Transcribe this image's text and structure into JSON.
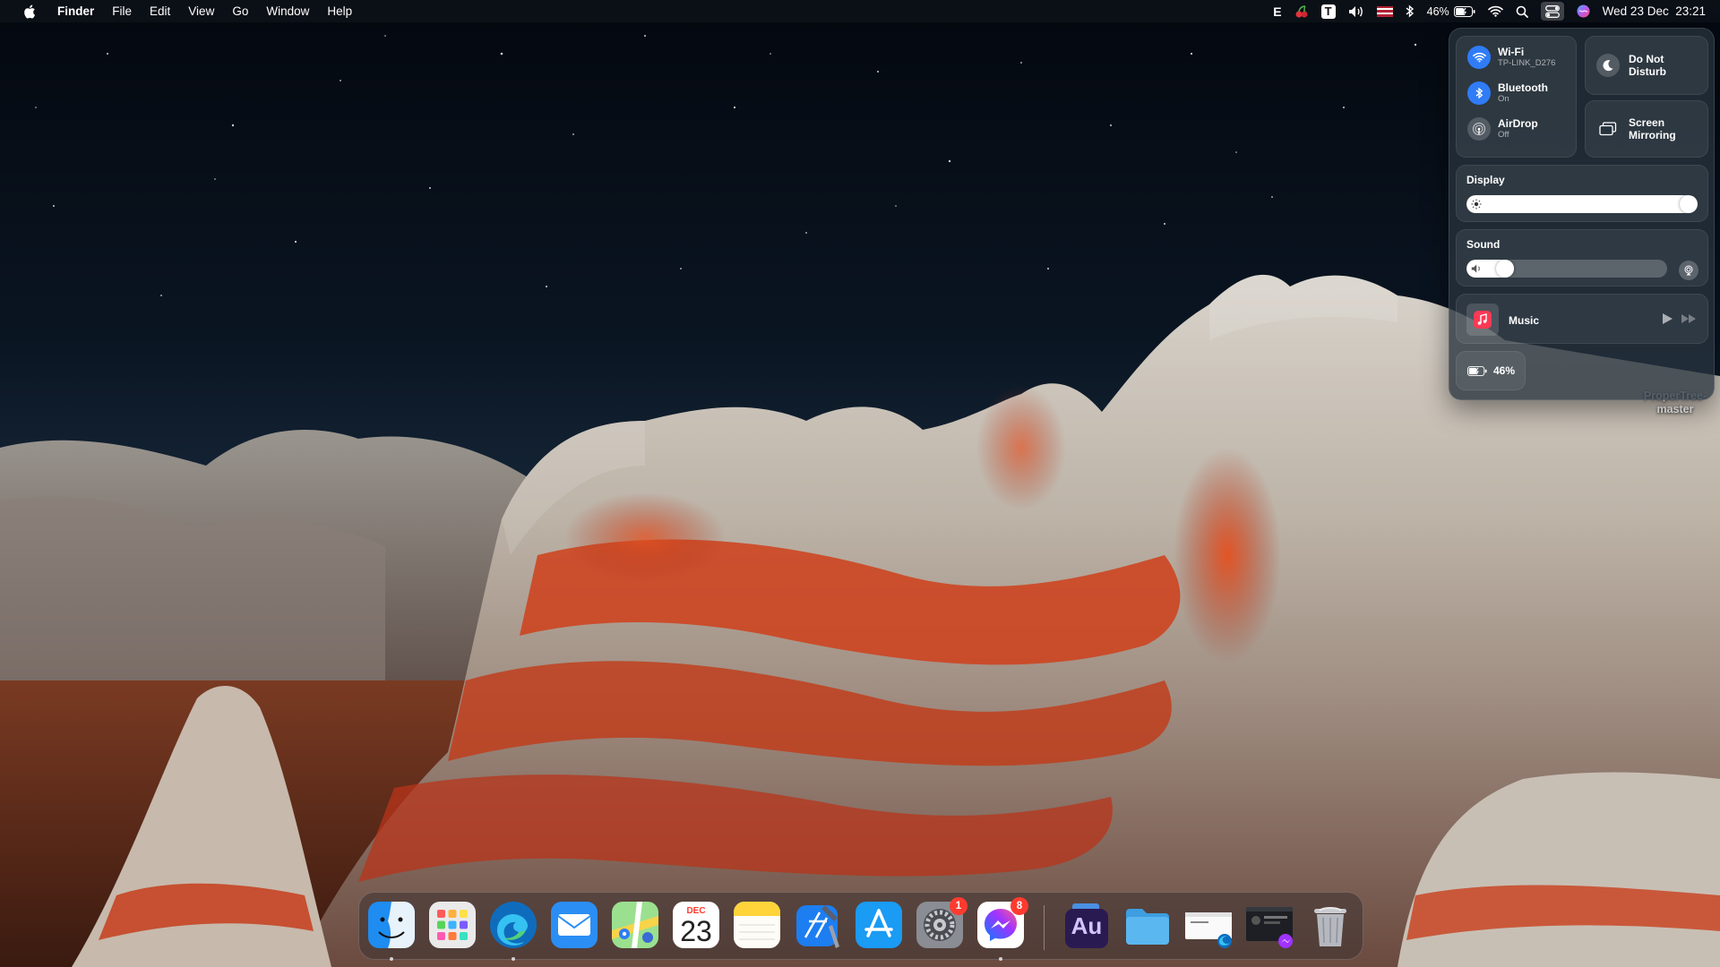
{
  "menubar": {
    "apple_icon": "apple-logo-icon",
    "app_name": "Finder",
    "menus": [
      "File",
      "Edit",
      "View",
      "Go",
      "Window",
      "Help"
    ],
    "status": {
      "keyboard_letter": "E",
      "text_expander_letter": "T",
      "battery_percent": "46%",
      "clock": "Wed 23 Dec  23:21"
    }
  },
  "control_center": {
    "wifi": {
      "title": "Wi-Fi",
      "subtitle": "TP-LINK_D276",
      "state": "on"
    },
    "bluetooth": {
      "title": "Bluetooth",
      "subtitle": "On",
      "state": "on"
    },
    "airdrop": {
      "title": "AirDrop",
      "subtitle": "Off",
      "state": "off"
    },
    "do_not_disturb": {
      "line1": "Do Not",
      "line2": "Disturb"
    },
    "screen_mirroring": {
      "line1": "Screen",
      "line2": "Mirroring"
    },
    "display": {
      "label": "Display",
      "brightness": 1.0
    },
    "sound": {
      "label": "Sound",
      "volume": 0.16
    },
    "now_playing": {
      "label": "Music"
    },
    "battery": {
      "label": "46%",
      "level": 0.46
    }
  },
  "desktop": {
    "folder": {
      "line1": "ProperTree-",
      "line2": "master"
    }
  },
  "dock": {
    "calendar": {
      "month": "DEC",
      "day": "23"
    },
    "audition_label": "Au",
    "settings_badge": "1",
    "messenger_badge": "8"
  },
  "colors": {
    "accent_blue": "#2f7cf6",
    "badge_red": "#ff3b30",
    "sky_top": "#04080f",
    "rock_orange": "#d2431c"
  }
}
